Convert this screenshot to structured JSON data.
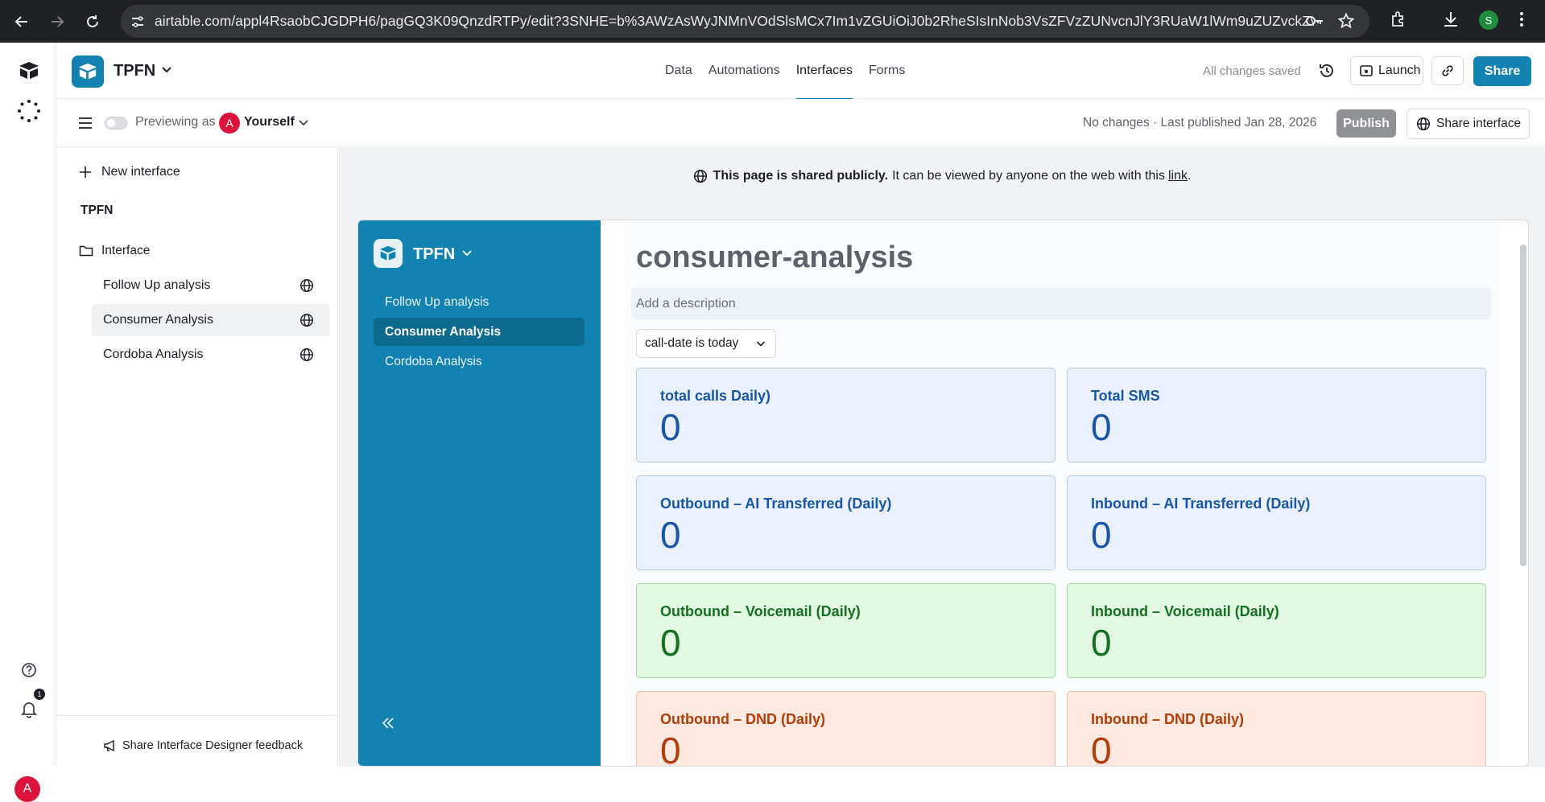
{
  "browser": {
    "url": "airtable.com/appl4RsaobCJGDPH6/pagGQ3K09QnzdRTPy/edit?3SNHE=b%3AWzAsWyJNMnVOdSlsMCx7Im1vZGUiOiJ0b2RheSIsInNob3VsZFVzZUNvcnJlY3RUaW1lWm9uZUZvckZvc...",
    "profile_initial": "S"
  },
  "rail": {
    "notification_count": "1",
    "avatar_initial": "A"
  },
  "header": {
    "base_name": "TPFN",
    "tabs": [
      {
        "label": "Data"
      },
      {
        "label": "Automations"
      },
      {
        "label": "Interfaces"
      },
      {
        "label": "Forms"
      }
    ],
    "saved_status": "All changes saved",
    "launch_label": "Launch",
    "share_label": "Share",
    "accent_color": "#1283b0"
  },
  "subheader": {
    "previewing_label": "Previewing as",
    "user_initial": "A",
    "user_name": "Yourself",
    "publish_info": "No changes · Last published Jan 28, 2026",
    "publish_label": "Publish",
    "share_interface_label": "Share interface"
  },
  "sidebar": {
    "new_interface_label": "New interface",
    "section_title": "TPFN",
    "folder_label": "Interface",
    "pages": [
      {
        "label": "Follow Up analysis"
      },
      {
        "label": "Consumer Analysis"
      },
      {
        "label": "Cordoba Analysis"
      }
    ],
    "feedback_label": "Share Interface Designer feedback"
  },
  "banner": {
    "bold": "This page is shared publicly.",
    "text": "It can be viewed by anyone on the web with this",
    "link": "link",
    "end": "."
  },
  "interface": {
    "app_name": "TPFN",
    "nav": [
      {
        "label": "Follow Up analysis"
      },
      {
        "label": "Consumer Analysis"
      },
      {
        "label": "Cordoba Analysis"
      }
    ],
    "page_title": "consumer-analysis",
    "description_placeholder": "Add a description",
    "filter_label": "call-date is today",
    "cards": [
      {
        "title": "total calls Daily)",
        "value": "0"
      },
      {
        "title": "Total SMS",
        "value": "0"
      },
      {
        "title": "Outbound – AI Transferred (Daily)",
        "value": "0"
      },
      {
        "title": "Inbound – AI Transferred (Daily)",
        "value": "0"
      },
      {
        "title": "Outbound – Voicemail (Daily)",
        "value": "0"
      },
      {
        "title": "Inbound – Voicemail (Daily)",
        "value": "0"
      },
      {
        "title": "Outbound – DND (Daily)",
        "value": "0"
      },
      {
        "title": "Inbound – DND (Daily)",
        "value": "0"
      }
    ],
    "colors": {
      "blue": "#1a56a8",
      "green": "#14711f",
      "orange": "#b13d0b",
      "sidebar": "#1283b0"
    }
  }
}
